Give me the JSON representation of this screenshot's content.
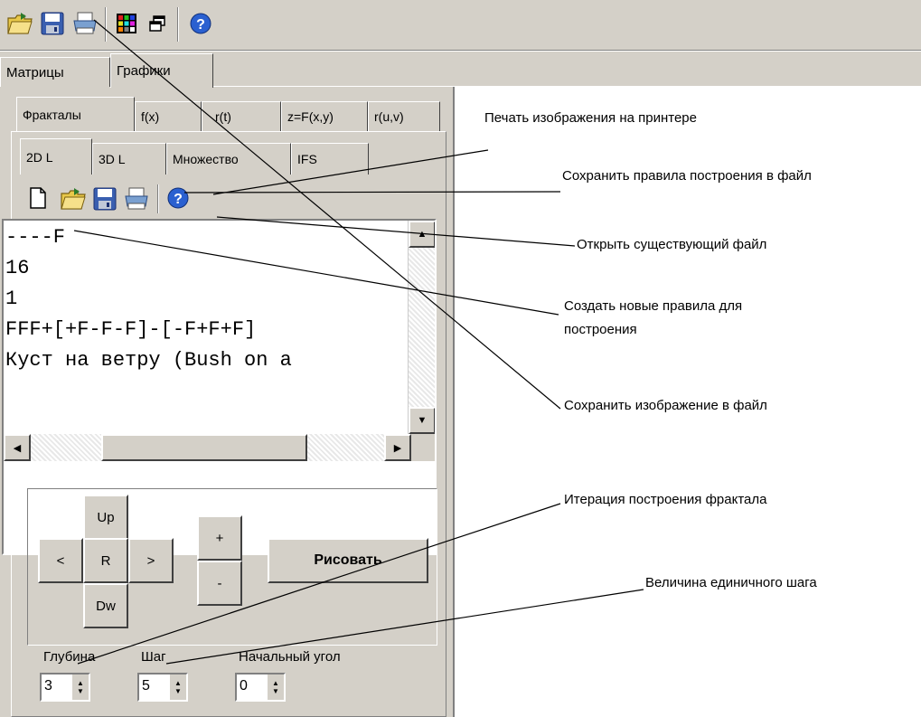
{
  "toolbar": {
    "icons": [
      "open-folder-icon",
      "save-disk-icon",
      "printer-icon",
      "color-grid-icon",
      "windows-icon",
      "help-icon"
    ]
  },
  "main_tabs": [
    {
      "label": "Матрицы",
      "active": false
    },
    {
      "label": "Графики",
      "active": true
    }
  ],
  "graph_tabs": [
    {
      "label": "Фракталы",
      "active": true
    },
    {
      "label": "f(x)",
      "active": false
    },
    {
      "label": "r(t)",
      "active": false
    },
    {
      "label": "z=F(x,y)",
      "active": false
    },
    {
      "label": "r(u,v)",
      "active": false
    }
  ],
  "fractal_tabs": [
    {
      "label": "2D L",
      "active": true
    },
    {
      "label": "3D L",
      "active": false
    },
    {
      "label": "Множество",
      "active": false
    },
    {
      "label": "IFS",
      "active": false
    }
  ],
  "inner_toolbar": {
    "icons": [
      "new-file-icon",
      "open-folder-icon",
      "save-disk-icon",
      "printer-icon",
      "help-icon"
    ]
  },
  "editor": {
    "lines": [
      "----F",
      "16",
      "1",
      "FFF+[+F-F-F]-[-F+F+F]",
      "Куст на ветру (Bush on a"
    ]
  },
  "nav_buttons": {
    "up": "Up",
    "left": "<",
    "center": "R",
    "right": ">",
    "down": "Dw",
    "plus": "+",
    "minus": "-",
    "draw": "Рисовать"
  },
  "params": {
    "depth": {
      "label": "Глубина",
      "value": "3"
    },
    "step": {
      "label": "Шаг",
      "value": "5"
    },
    "angle": {
      "label": "Начальный угол",
      "value": "0"
    }
  },
  "annotations": {
    "print": "Печать изображения на принтере",
    "save_rules": "Сохранить правила построения в файл",
    "open_file": "Открыть существующий файл",
    "new_rules_1": "Создать новые правила для",
    "new_rules_2": "построения",
    "save_image": "Сохранить изображение в файл",
    "iteration": "Итерация построения фрактала",
    "step_size": "Величина единичного шага"
  }
}
